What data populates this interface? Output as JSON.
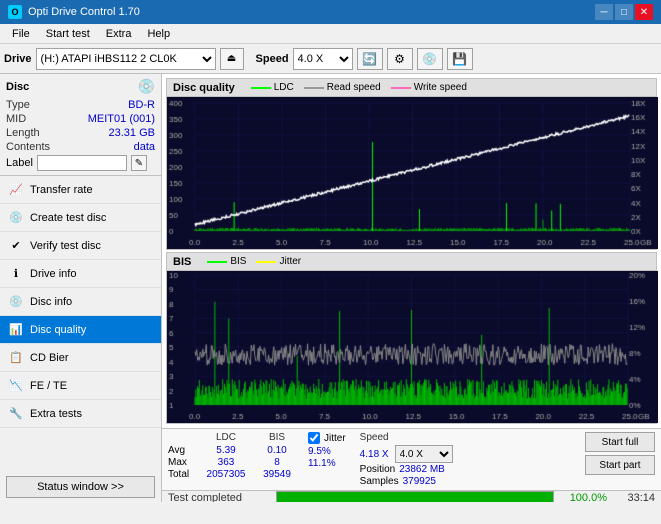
{
  "titlebar": {
    "title": "Opti Drive Control 1.70",
    "controls": [
      "─",
      "□",
      "✕"
    ]
  },
  "menubar": {
    "items": [
      "File",
      "Start test",
      "Extra",
      "Help"
    ]
  },
  "drivetoolbar": {
    "drive_label": "Drive",
    "drive_value": "(H:) ATAPI iHBS112  2 CL0K",
    "speed_label": "Speed",
    "speed_value": "4.0 X"
  },
  "disc": {
    "title": "Disc",
    "type_label": "Type",
    "type_value": "BD-R",
    "mid_label": "MID",
    "mid_value": "MEIT01 (001)",
    "length_label": "Length",
    "length_value": "23.31 GB",
    "contents_label": "Contents",
    "contents_value": "data",
    "label_label": "Label",
    "label_value": ""
  },
  "nav": {
    "items": [
      {
        "id": "transfer-rate",
        "label": "Transfer rate",
        "icon": "📈"
      },
      {
        "id": "create-test-disc",
        "label": "Create test disc",
        "icon": "💿"
      },
      {
        "id": "verify-test-disc",
        "label": "Verify test disc",
        "icon": "✔"
      },
      {
        "id": "drive-info",
        "label": "Drive info",
        "icon": "ℹ"
      },
      {
        "id": "disc-info",
        "label": "Disc info",
        "icon": "💿"
      },
      {
        "id": "disc-quality",
        "label": "Disc quality",
        "icon": "📊",
        "active": true
      },
      {
        "id": "cd-bier",
        "label": "CD Bier",
        "icon": "📋"
      },
      {
        "id": "fe-te",
        "label": "FE / TE",
        "icon": "📉"
      },
      {
        "id": "extra-tests",
        "label": "Extra tests",
        "icon": "🔧"
      }
    ],
    "status_button": "Status window >>"
  },
  "chart": {
    "title": "Disc quality",
    "top_panel": {
      "title": "LDC",
      "legends": [
        {
          "label": "LDC",
          "color": "#00ff00"
        },
        {
          "label": "Read speed",
          "color": "#ffffff"
        },
        {
          "label": "Write speed",
          "color": "#ff69b4"
        }
      ],
      "y_max": 400,
      "y_right_max": 18,
      "x_max": 25.0
    },
    "bottom_panel": {
      "title": "BIS",
      "legends": [
        {
          "label": "BIS",
          "color": "#00ff00"
        },
        {
          "label": "Jitter",
          "color": "#ffff00"
        }
      ],
      "y_max": 10,
      "y_right_max": 20,
      "x_max": 25.0
    }
  },
  "stats": {
    "headers": [
      "LDC",
      "BIS",
      "",
      "Jitter",
      "Speed",
      ""
    ],
    "rows": [
      {
        "label": "Avg",
        "ldc": "5.39",
        "bis": "0.10",
        "jitter": "9.5%",
        "speed_label": "4.18 X",
        "speed_select": "4.0 X"
      },
      {
        "label": "Max",
        "ldc": "363",
        "bis": "8",
        "jitter": "11.1%",
        "position_label": "Position",
        "position_val": "23862 MB"
      },
      {
        "label": "Total",
        "ldc": "2057305",
        "bis": "39549",
        "samples_label": "Samples",
        "samples_val": "379925"
      }
    ],
    "buttons": [
      "Start full",
      "Start part"
    ],
    "jitter_checked": true
  },
  "progress": {
    "status_text": "Test completed",
    "percent": 100,
    "percent_text": "100.0%",
    "time": "33:14"
  }
}
